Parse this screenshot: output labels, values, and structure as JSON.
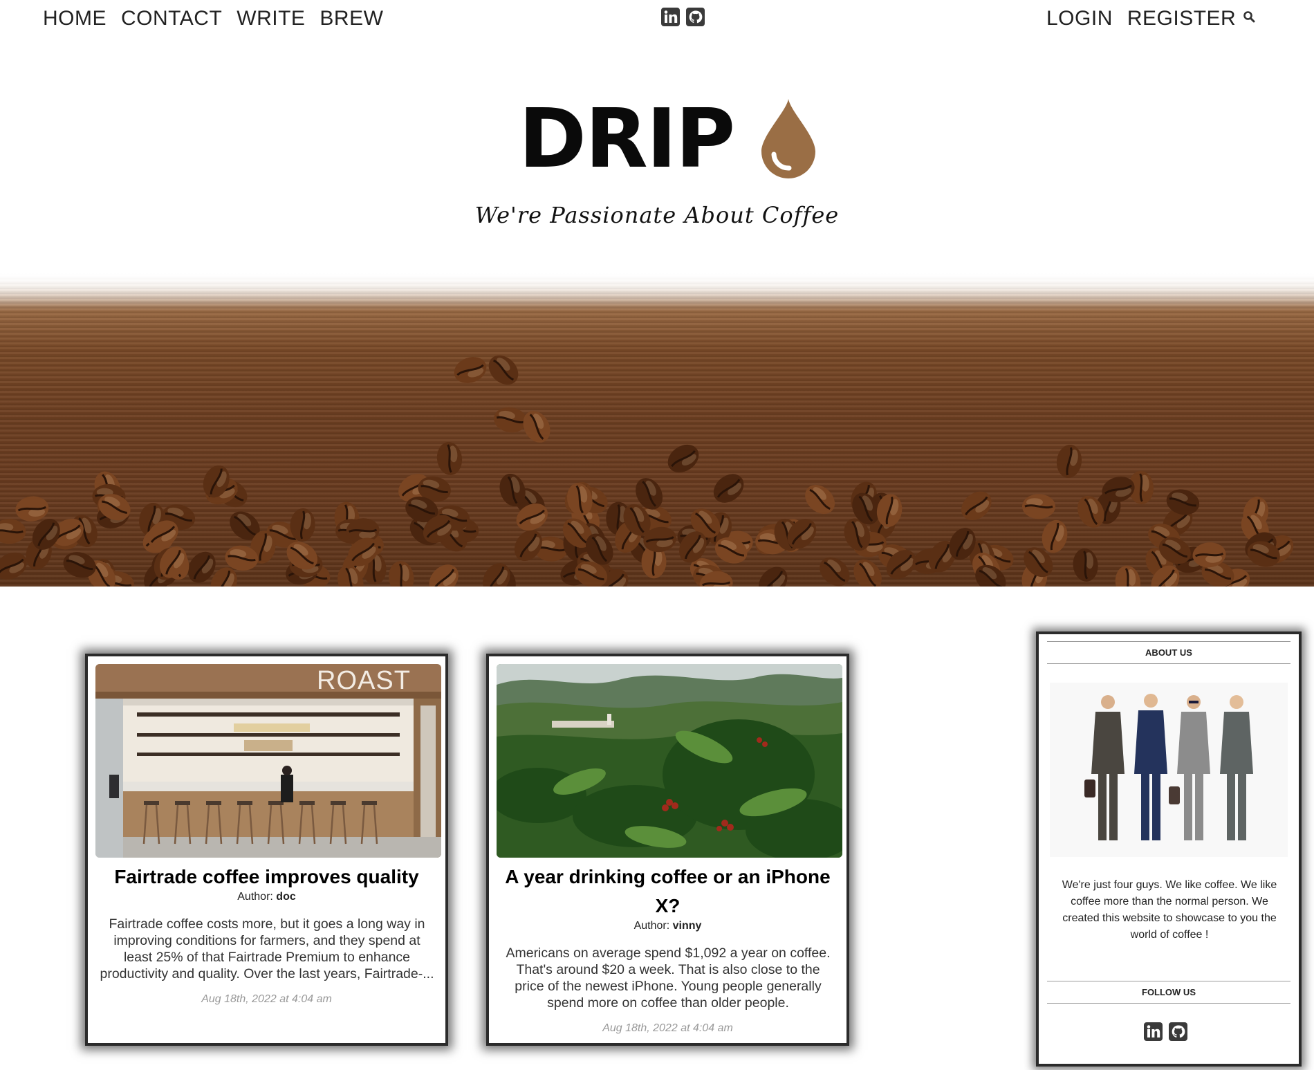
{
  "nav": {
    "left": [
      "HOME",
      "CONTACT",
      "WRITE",
      "BREW"
    ],
    "right": [
      "LOGIN",
      "REGISTER"
    ],
    "social": [
      "linkedin-icon",
      "github-icon"
    ],
    "search_icon": "search-icon"
  },
  "brand": {
    "name": "DRIP",
    "tagline": "We're Passionate About Coffee",
    "drop_color": "#9a6e45"
  },
  "posts": [
    {
      "title": "Fairtrade coffee improves quality",
      "author_label": "Author:",
      "author": "doc",
      "excerpt": "Fairtrade coffee costs more, but it goes a long way in improving conditions for farmers, and they spend at least 25% of that Fairtrade Premium to enhance productivity and quality. Over the last years, Fairtrade-...",
      "date": "Aug 18th, 2022 at 4:04 am",
      "image_text": "ROAST"
    },
    {
      "title": "A year drinking coffee or an iPhone X?",
      "author_label": "Author:",
      "author": "vinny",
      "excerpt": "Americans on average spend $1,092 a year on coffee. That's around $20 a week. That is also close to the price of the newest iPhone. Young people generally spend more on coffee than older people.",
      "date": "Aug 18th, 2022 at 4:04 am"
    }
  ],
  "sidebar": {
    "about_title": "ABOUT US",
    "about_text": "We're just four guys. We like coffee. We like coffee more than the normal person. We created this website to showcase to you the world of coffee !",
    "follow_title": "FOLLOW US",
    "social": [
      "linkedin-icon",
      "github-icon"
    ]
  }
}
